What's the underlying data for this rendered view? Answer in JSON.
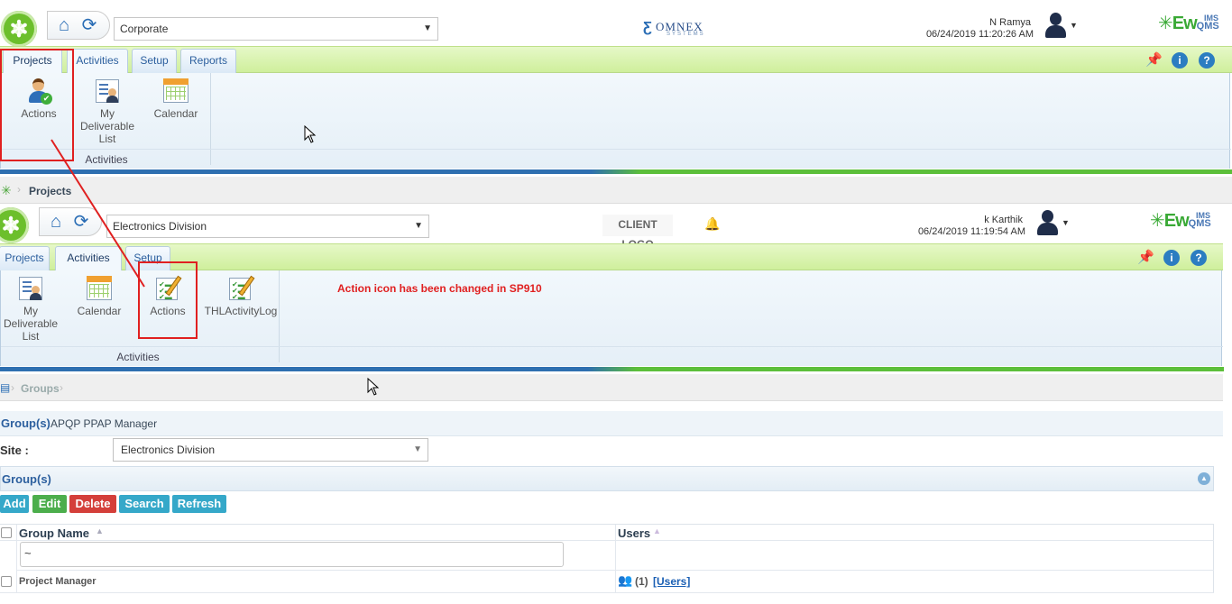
{
  "top_window": {
    "site": "Corporate",
    "vendor_logo": "OMNEX",
    "vendor_sub": "SYSTEMS",
    "user_name": "N Ramya",
    "datetime": "06/24/2019 11:20:26 AM",
    "brand": "Ew",
    "brand_qms": "QMS",
    "brand_ims": "IMS",
    "tabs": [
      "Projects",
      "Activities",
      "Setup",
      "Reports"
    ],
    "ribbon_buttons": [
      {
        "label": "Actions",
        "icon": "user-check-icon"
      },
      {
        "label": "My Deliverable List",
        "icon": "deliverable-list-icon"
      },
      {
        "label": "Calendar",
        "icon": "calendar-icon"
      }
    ],
    "group_label": "Activities"
  },
  "breadcrumb_top": {
    "item": "Projects"
  },
  "bottom_window": {
    "site": "Electronics Division",
    "client_logo": "CLIENT LOGO",
    "user_name": "k Karthik",
    "datetime": "06/24/2019 11:19:54 AM",
    "brand": "Ew",
    "brand_qms": "QMS",
    "brand_ims": "IMS",
    "tabs": [
      "Projects",
      "Activities",
      "Setup"
    ],
    "ribbon_buttons": [
      {
        "label": "My Deliverable List",
        "icon": "deliverable-list-icon"
      },
      {
        "label": "Calendar",
        "icon": "calendar-icon"
      },
      {
        "label": "Actions",
        "icon": "checklist-pencil-icon"
      },
      {
        "label": "THLActivityLog",
        "icon": "checklist-pencil-icon"
      }
    ],
    "group_label": "Activities",
    "annotation": "Action icon has been changed in SP910"
  },
  "breadcrumb_bottom": {
    "item": "Groups"
  },
  "groups_page": {
    "title_prefix": "Group(s)",
    "title_name": "APQP PPAP Manager",
    "site_label": "Site :",
    "site_value": "Electronics Division",
    "section_title": "Group(s)",
    "buttons": [
      {
        "label": "Add",
        "color": "#35a8c9"
      },
      {
        "label": "Edit",
        "color": "#4cae4c"
      },
      {
        "label": "Delete",
        "color": "#d43f3a"
      },
      {
        "label": "Search",
        "color": "#35a8c9"
      },
      {
        "label": "Refresh",
        "color": "#35a8c9"
      }
    ],
    "columns": [
      "Group Name",
      "Users"
    ],
    "filter_value": "~",
    "rows": [
      {
        "group_name": "Project Manager",
        "users_count": "(1)",
        "users_link": "[Users]"
      }
    ]
  }
}
